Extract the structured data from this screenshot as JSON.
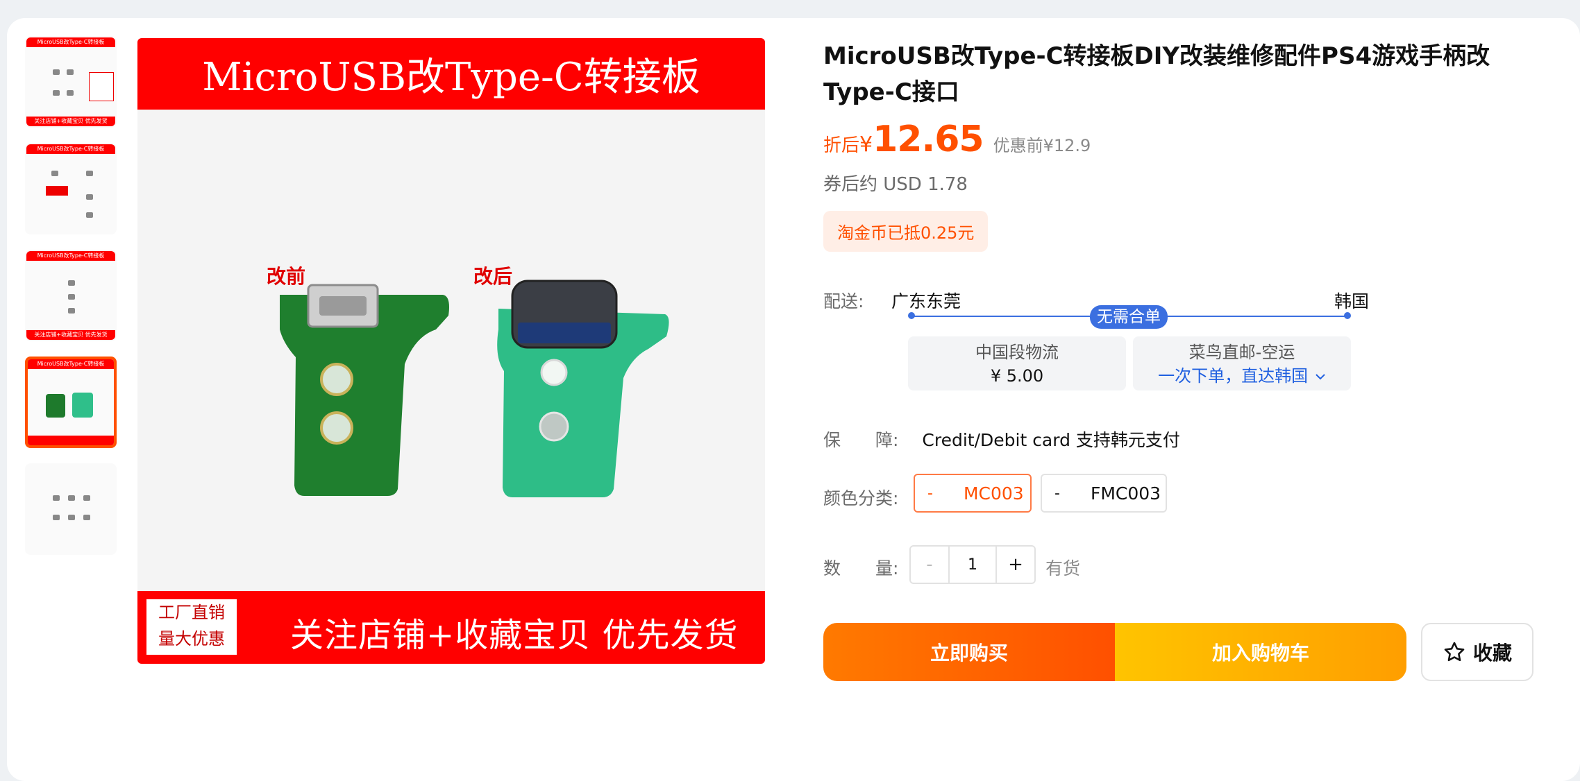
{
  "gallery": {
    "thumb_top_text": "MicroUSB改Type-C转接板",
    "thumb_bottom_text": "关注店铺+收藏宝贝 优先发货",
    "banner_title": "MicroUSB改Type-C转接板",
    "factory_line1": "工厂直销",
    "factory_line2": "量大优惠",
    "promo": "关注店铺+收藏宝贝  优先发货",
    "label_before": "改前",
    "label_after": "改后",
    "active_thumb_index": 4
  },
  "product": {
    "title": "MicroUSB改Type-C转接板DIY改装维修配件PS4游戏手柄改Type-C接口",
    "price_label": "折后",
    "currency": "¥",
    "price": "12.65",
    "original_price": "优惠前¥12.9",
    "usd": "券后约 USD 1.78",
    "coin_text": "淘金币已抵0.25元"
  },
  "shipping": {
    "label": "配送:",
    "from": "广东东莞",
    "to": "韩国",
    "badge": "无需合单",
    "option1_title": "中国段物流",
    "option1_price": "¥ 5.00",
    "option2_title": "菜鸟直邮-空运",
    "option2_link": "一次下单，直达韩国"
  },
  "guarantee": {
    "label": "保　　障:",
    "value": "Credit/Debit card 支持韩元支付"
  },
  "colors": {
    "label": "颜色分类:",
    "options": [
      {
        "dash": "-",
        "name": "MC003",
        "selected": true
      },
      {
        "dash": "-",
        "name": "FMC003",
        "selected": false
      }
    ]
  },
  "quantity": {
    "label": "数　　量:",
    "minus": "-",
    "value": "1",
    "plus": "+",
    "stock": "有货"
  },
  "actions": {
    "buy_now": "立即购买",
    "add_to_cart": "加入购物车",
    "favorite": "收藏"
  },
  "colors_theme": {
    "accent": "#ff5000",
    "link_blue": "#1f5fe0",
    "banner_red": "#ff0000"
  },
  "icons": {
    "favorite": "star-outline-icon",
    "dropdown": "chevron-down-icon"
  }
}
